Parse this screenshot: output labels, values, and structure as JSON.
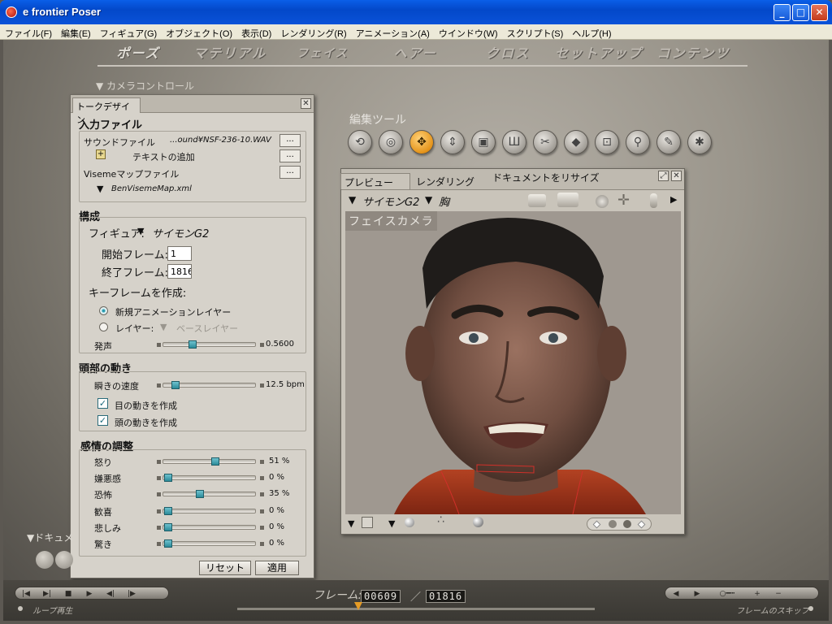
{
  "window": {
    "title": "e frontier Poser",
    "min": "_",
    "max": "□",
    "close": "✕"
  },
  "menu": [
    "ファイル(F)",
    "編集(E)",
    "フィギュア(G)",
    "オブジェクト(O)",
    "表示(D)",
    "レンダリング(R)",
    "アニメーション(A)",
    "ウインドウ(W)",
    "スクリプト(S)",
    "ヘルプ(H)"
  ],
  "tabs": [
    "ポーズ",
    "マテリアル",
    "フェイス",
    "ヘアー",
    "クロス",
    "セットアップ",
    "コンテンツ"
  ],
  "active_tab": "ポーズ",
  "camera_control": "カメラコントロール",
  "edit_tools": {
    "label": "編集ツール",
    "icons": [
      "rotate-icon",
      "twist-icon",
      "translate-icon",
      "translate-in-out-icon",
      "scale-icon",
      "taper-icon",
      "chain-break-icon",
      "color-icon",
      "grouping-icon",
      "view-magnifier-icon",
      "morphing-tool-icon",
      "direct-manipulation-icon"
    ],
    "active_index": 2
  },
  "talk_designer": {
    "tab": "トークデザイン",
    "input_file": {
      "header": "入力ファイル",
      "sound_label": "サウンドファイル",
      "sound_value": "...ound¥NSF-236-10.WAV",
      "add_text": "テキストの追加",
      "viseme_label": "Visemeマップファイル",
      "viseme_value": "BenVisemeMap.xml",
      "browse": "..."
    },
    "config": {
      "header": "構成",
      "figure_label": "フィギュア:",
      "figure_value": "サイモンG2",
      "start_label": "開始フレーム:",
      "start_value": "1",
      "end_label": "終了フレーム:",
      "end_value": "1816",
      "keyframe_label": "キーフレームを作成:",
      "opt_new_layer": "新規アニメーションレイヤー",
      "opt_layer": "レイヤー:",
      "layer_value": "ベースレイヤー",
      "enunciation_label": "発声",
      "enunciation_value": "0.5600",
      "enunciation_level": 0.3
    },
    "head_motion": {
      "header": "頭部の動き",
      "blink_label": "瞬きの速度",
      "blink_value": "12.5 bpm",
      "blink_level": 0.12,
      "eye_motion": "目の動きを作成",
      "head_motion": "頭の動きを作成"
    },
    "emotion": {
      "header": "感情の調整",
      "items": [
        {
          "label": "怒り",
          "value": "51 %",
          "level": 0.51
        },
        {
          "label": "嫌悪感",
          "value": "0 %",
          "level": 0
        },
        {
          "label": "恐怖",
          "value": "35 %",
          "level": 0.35
        },
        {
          "label": "歓喜",
          "value": "0 %",
          "level": 0
        },
        {
          "label": "悲しみ",
          "value": "0 %",
          "level": 0
        },
        {
          "label": "驚き",
          "value": "0 %",
          "level": 0
        }
      ]
    },
    "reset": "リセット",
    "apply": "適用"
  },
  "preview": {
    "tab_preview": "プレビュー",
    "tab_render": "レンダリング",
    "resize": "ドキュメントをリサイズ",
    "figure": "サイモンG2",
    "part": "胸",
    "camera_name": "フェイスカメラ"
  },
  "doc_label": "ドキュメ",
  "bottom": {
    "loop": "ループ再生",
    "frame_label": "フレーム:",
    "frame_current": "00609",
    "frame_total": "01816",
    "skip": "フレームのスキップ"
  }
}
